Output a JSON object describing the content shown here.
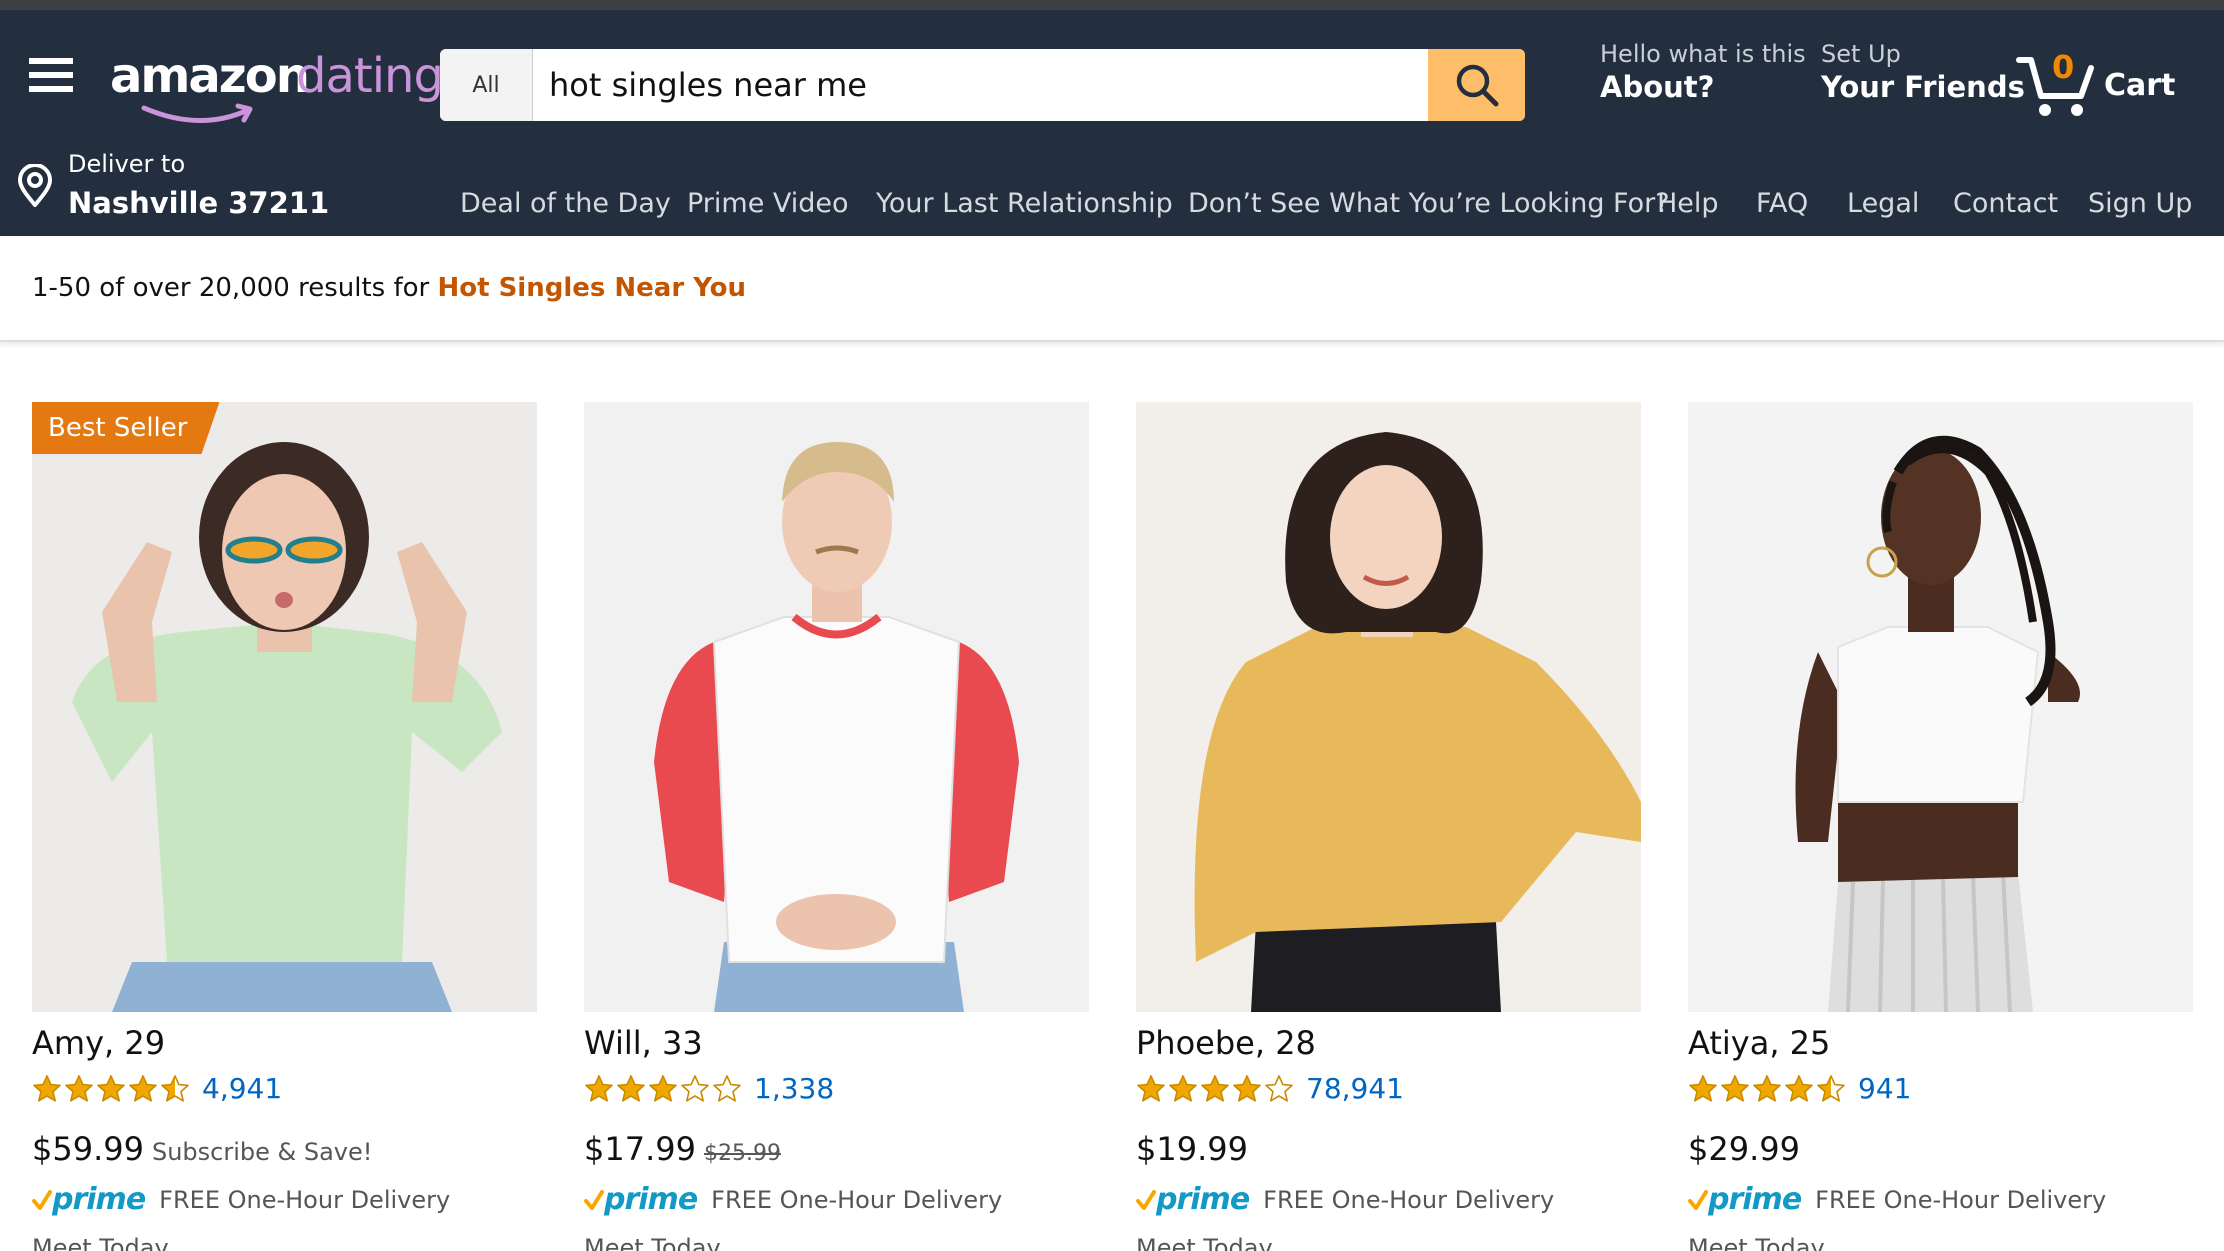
{
  "header": {
    "menu_icon": "hamburger-menu-icon",
    "logo": {
      "part1": "amazon",
      "part2": "dating"
    },
    "search": {
      "category": "All",
      "query": "hot singles near me",
      "search_icon": "search-icon"
    },
    "about": {
      "line1": "Hello what is this",
      "line2": "About?"
    },
    "friends": {
      "line1": "Set Up",
      "line2": "Your Friends"
    },
    "cart": {
      "count": "0",
      "label": "Cart",
      "icon": "cart-icon"
    },
    "deliver": {
      "line1": "Deliver to",
      "line2": "Nashville 37211",
      "icon": "location-pin-icon"
    },
    "nav": [
      "Deal of the Day",
      "Prime Video",
      "Your Last Relationship",
      "Don’t See What You’re Looking For?",
      "Help",
      "FAQ",
      "Legal",
      "Contact",
      "Sign Up"
    ]
  },
  "results": {
    "prefix": "1-50 of over 20,000 results for ",
    "query": "Hot Singles Near You"
  },
  "products": [
    {
      "badge": "Best Seller",
      "name": "Amy, 29",
      "rating": 4.5,
      "reviews": "4,941",
      "price": "$59.99",
      "note": "Subscribe & Save!",
      "prime": "prime",
      "delivery": "FREE One-Hour Delivery",
      "meet": "Meet Today"
    },
    {
      "name": "Will, 33",
      "rating": 3,
      "reviews": "1,338",
      "price": "$17.99",
      "old_price": "$25.99",
      "prime": "prime",
      "delivery": "FREE One-Hour Delivery",
      "meet": "Meet Today"
    },
    {
      "name": "Phoebe, 28",
      "rating": 4,
      "reviews": "78,941",
      "price": "$19.99",
      "prime": "prime",
      "delivery": "FREE One-Hour Delivery",
      "meet": "Meet Today"
    },
    {
      "name": "Atiya, 25",
      "rating": 4.5,
      "reviews": "941",
      "price": "$29.99",
      "prime": "prime",
      "delivery": "FREE One-Hour Delivery",
      "meet": "Meet Today"
    }
  ],
  "colors": {
    "header_bg": "#232f3e",
    "search_button": "#febd69",
    "badge": "#e47911",
    "star": "#f0a800",
    "link": "#0066c0",
    "query_highlight": "#c45500",
    "prime_blue": "#1399c6"
  }
}
